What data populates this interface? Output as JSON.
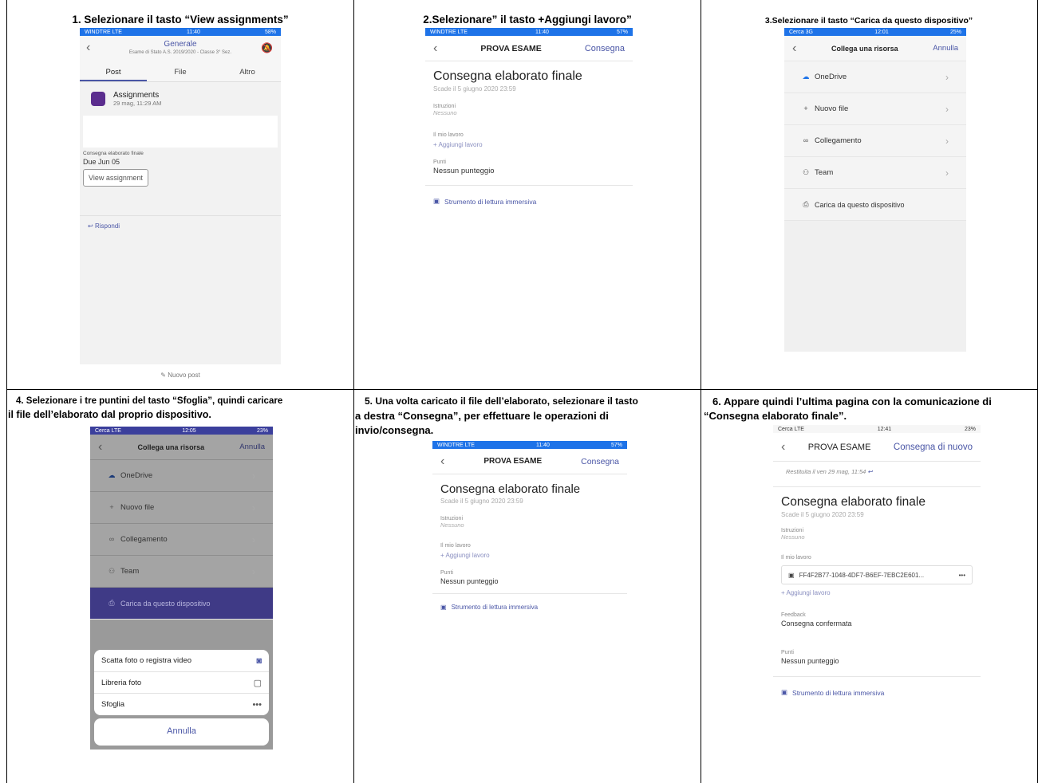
{
  "captions": {
    "c1": "1. Selezionare il tasto “View assignments”",
    "c2": "2.Selezionare” il tasto +Aggiungi lavoro”",
    "c3": "3.Selezionare il tasto “Carica da questo dispositivo”",
    "c4a": "4. Selezionare i tre puntini del tasto “Sfoglia”, quindi caricare",
    "c4b": "il file dell’elaborato dal proprio dispositivo.",
    "c5a": "5. Una volta caricato il file dell’elaborato, selezionare il tasto",
    "c5b": "a destra “Consegna”, per effettuare le operazioni di",
    "c5c": "invio/consegna.",
    "c6a": "6. Appare quindi l’ultima pagina con la comunicazione di",
    "c6b": "“Consegna elaborato finale”."
  },
  "s1": {
    "status": {
      "left": "WINDTRE LTE",
      "time": "11:40",
      "battery": "58%"
    },
    "channel": "Generale",
    "team": "Esame di Stato A.S. 2019/2020 - Classe 3° Sez.",
    "tabs": [
      "Post",
      "File",
      "Altro"
    ],
    "app_name": "Assignments",
    "app_time": "29 mag, 11:29 AM",
    "assignment_title": "Consegna elaborato finale",
    "due": "Due Jun 05",
    "view_button": "View assignment",
    "reply": "Rispondi",
    "new_post": "Nuovo post"
  },
  "s2": {
    "status": {
      "left": "WINDTRE LTE",
      "time": "11:40",
      "battery": "57%"
    },
    "header_title": "PROVA ESAME",
    "header_action": "Consegna",
    "title": "Consegna elaborato finale",
    "due": "Scade il 5 giugno 2020 23:59",
    "instr_label": "Istruzioni",
    "instr_value": "Nessuno",
    "work_label": "Il mio lavoro",
    "add_work": "Aggiungi lavoro",
    "points_label": "Punti",
    "points_value": "Nessun punteggio",
    "reader": "Strumento di lettura immersiva"
  },
  "s3": {
    "status": {
      "left": "Cerca 3G",
      "time": "12:01",
      "battery": "25%"
    },
    "header_title": "Collega una risorsa",
    "header_action": "Annulla",
    "rows": [
      "OneDrive",
      "Nuovo file",
      "Collegamento",
      "Team"
    ],
    "upload": "Carica da questo dispositivo"
  },
  "s4": {
    "status": {
      "left": "Cerca LTE",
      "time": "12:05",
      "battery": "23%"
    },
    "header_title": "Collega una risorsa",
    "header_action": "Annulla",
    "rows": [
      "OneDrive",
      "Nuovo file",
      "Collegamento",
      "Team"
    ],
    "upload": "Carica da questo dispositivo",
    "sheet": [
      "Scatta foto o registra video",
      "Libreria foto",
      "Sfoglia"
    ],
    "cancel": "Annulla"
  },
  "s5": {
    "status": {
      "left": "WINDTRE LTE",
      "time": "11:40",
      "battery": "57%"
    },
    "header_title": "PROVA ESAME",
    "header_action": "Consegna",
    "title": "Consegna elaborato finale",
    "due": "Scade il 5 giugno 2020 23:59",
    "instr_label": "Istruzioni",
    "instr_value": "Nessuno",
    "work_label": "Il mio lavoro",
    "add_work": "Aggiungi lavoro",
    "points_label": "Punti",
    "points_value": "Nessun punteggio",
    "reader": "Strumento di lettura immersiva"
  },
  "s6": {
    "status": {
      "left": "Cerca LTE",
      "time": "12:41",
      "battery": "23%"
    },
    "header_title": "PROVA ESAME",
    "header_action": "Consegna di nuovo",
    "returned": "Restituita il ven 29 mag, 11:54",
    "title": "Consegna elaborato finale",
    "due": "Scade il 5 giugno 2020 23:59",
    "instr_label": "Istruzioni",
    "instr_value": "Nessuno",
    "work_label": "Il mio lavoro",
    "file_name": "FF4F2B77-1048-4DF7-B6EF-7EBC2E601...",
    "add_work": "Aggiungi lavoro",
    "feedback_label": "Feedback",
    "feedback_value": "Consegna confermata",
    "points_label": "Punti",
    "points_value": "Nessun punteggio",
    "reader": "Strumento di lettura immersiva"
  }
}
